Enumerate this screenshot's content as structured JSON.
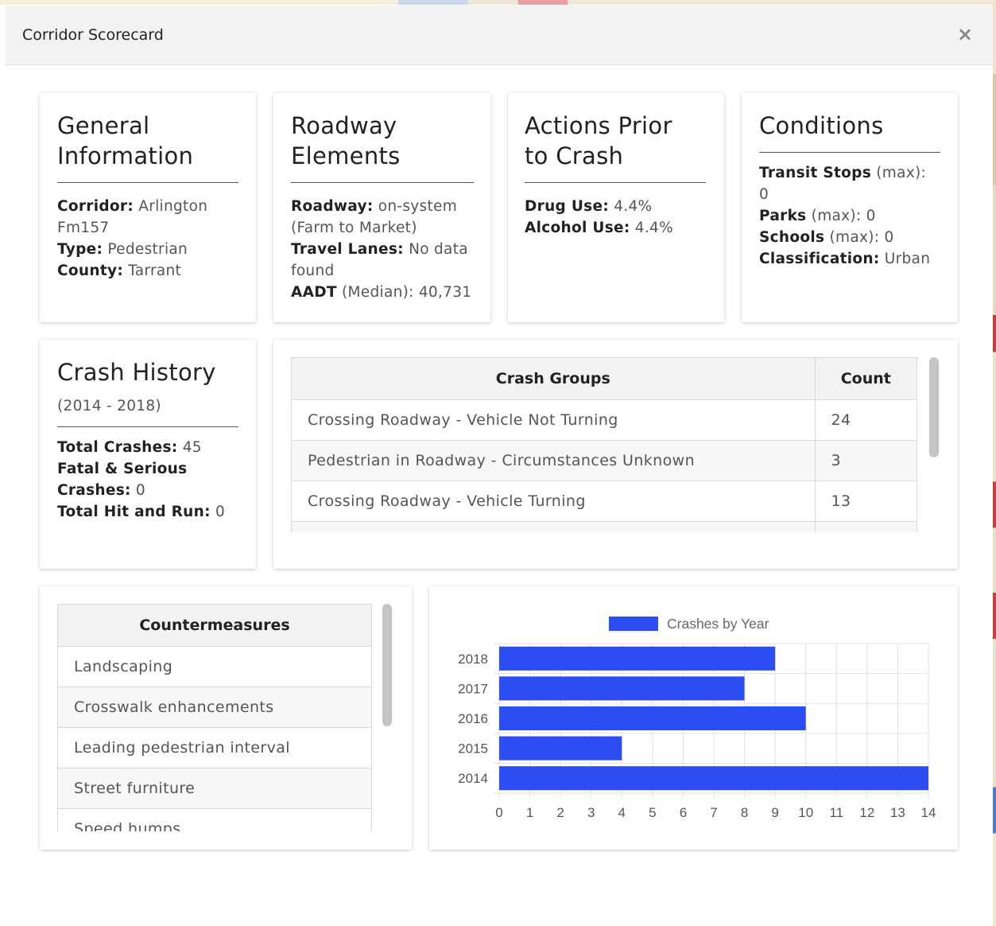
{
  "modal": {
    "title": "Corridor Scorecard",
    "close_glyph": "×"
  },
  "general": {
    "title_line1": "General",
    "title_line2": "Information",
    "corridor_label": "Corridor:",
    "corridor_value_1": "Arlington",
    "corridor_value_2": "Fm157",
    "type_label": "Type:",
    "type_value": "Pedestrian",
    "county_label": "County:",
    "county_value": "Tarrant"
  },
  "roadway": {
    "title_line1": "Roadway",
    "title_line2": "Elements",
    "roadway_label": "Roadway:",
    "roadway_value_1": "on-system",
    "roadway_value_2": "(Farm to Market)",
    "lanes_label": "Travel Lanes:",
    "lanes_value_1": "No data",
    "lanes_value_2": "found",
    "aadt_label": "AADT",
    "aadt_value": "(Median): 40,731"
  },
  "actions": {
    "title_line1": "Actions Prior",
    "title_line2": "to Crash",
    "drug_label": "Drug Use:",
    "drug_value": "4.4%",
    "alcohol_label": "Alcohol Use:",
    "alcohol_value": "4.4%"
  },
  "conditions": {
    "title": "Conditions",
    "transit_label": "Transit Stops",
    "transit_value": "(max): 0",
    "parks_label": "Parks",
    "parks_value": "(max): 0",
    "schools_label": "Schools",
    "schools_value": "(max): 0",
    "class_label": "Classification:",
    "class_value": "Urban"
  },
  "crash_history": {
    "title": "Crash History",
    "range": "(2014 - 2018)",
    "total_label": "Total Crashes:",
    "total_value": "45",
    "fatal_label_1": "Fatal & Serious",
    "fatal_label_2": "Crashes:",
    "fatal_value": "0",
    "hitrun_label": "Total Hit and Run:",
    "hitrun_value": "0"
  },
  "crash_groups": {
    "headers": [
      "Crash Groups",
      "Count"
    ],
    "rows": [
      [
        "Crossing Roadway - Vehicle Not Turning",
        "24"
      ],
      [
        "Pedestrian in Roadway - Circumstances Unknown",
        "3"
      ],
      [
        "Crossing Roadway - Vehicle Turning",
        "13"
      ]
    ]
  },
  "countermeasures": {
    "header": "Countermeasures",
    "items": [
      "Landscaping",
      "Crosswalk enhancements",
      "Leading pedestrian interval",
      "Street furniture",
      "Speed humps"
    ]
  },
  "chart_data": {
    "type": "bar",
    "orientation": "horizontal",
    "categories": [
      "2018",
      "2017",
      "2016",
      "2015",
      "2014"
    ],
    "series": [
      {
        "name": "Crashes by Year",
        "values": [
          9,
          8,
          10,
          4,
          14
        ],
        "color": "#2c4df2"
      }
    ],
    "xlim": [
      0,
      14
    ],
    "xticks": [
      "0",
      "1",
      "2",
      "3",
      "4",
      "5",
      "6",
      "7",
      "8",
      "9",
      "10",
      "11",
      "12",
      "13",
      "14"
    ],
    "grid": true,
    "legend": "top"
  }
}
